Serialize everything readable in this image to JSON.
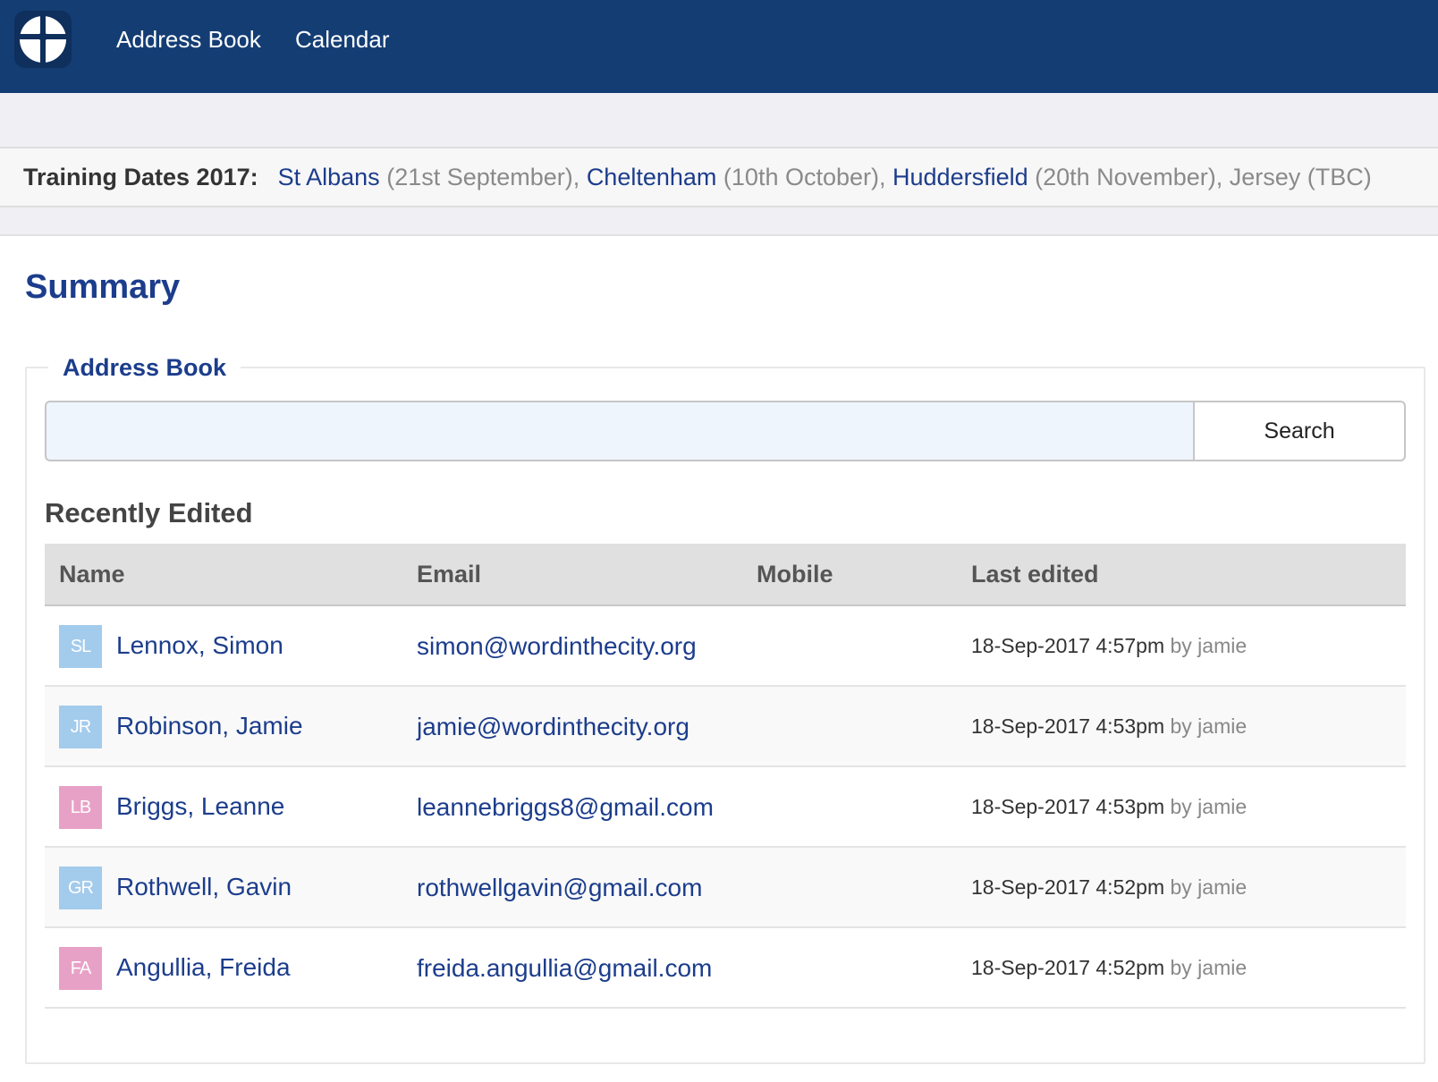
{
  "nav": {
    "logo_icon": "cross-logo-icon",
    "items": [
      "Address Book",
      "Calendar"
    ]
  },
  "training": {
    "label": "Training Dates 2017:",
    "entries": [
      {
        "city": "St Albans",
        "detail": "(21st September),"
      },
      {
        "city": "Cheltenham",
        "detail": "(10th October),"
      },
      {
        "city": "Huddersfield",
        "detail": "(20th November), Jersey (TBC)"
      }
    ]
  },
  "main": {
    "title": "Summary",
    "address_book": {
      "legend": "Address Book",
      "search": {
        "value": "",
        "placeholder": "",
        "button_label": "Search"
      },
      "recent_title": "Recently Edited",
      "columns": [
        "Name",
        "Email",
        "Mobile",
        "Last edited"
      ],
      "rows": [
        {
          "initials": "SL",
          "avatar_color": "#a3cbec",
          "name": "Lennox, Simon",
          "email": "simon@wordinthecity.org",
          "mobile": "",
          "edited": "18-Sep-2017 4:57pm",
          "by": "by jamie"
        },
        {
          "initials": "JR",
          "avatar_color": "#a3cbec",
          "name": "Robinson, Jamie",
          "email": "jamie@wordinthecity.org",
          "mobile": "",
          "edited": "18-Sep-2017 4:53pm",
          "by": "by jamie"
        },
        {
          "initials": "LB",
          "avatar_color": "#e8a1c6",
          "name": "Briggs, Leanne",
          "email": "leannebriggs8@gmail.com",
          "mobile": "",
          "edited": "18-Sep-2017 4:53pm",
          "by": "by jamie"
        },
        {
          "initials": "GR",
          "avatar_color": "#a3cbec",
          "name": "Rothwell, Gavin",
          "email": "rothwellgavin@gmail.com",
          "mobile": "",
          "edited": "18-Sep-2017 4:52pm",
          "by": "by jamie"
        },
        {
          "initials": "FA",
          "avatar_color": "#e8a1c6",
          "name": "Angullia, Freida",
          "email": "freida.angullia@gmail.com",
          "mobile": "",
          "edited": "18-Sep-2017 4:52pm",
          "by": "by jamie"
        }
      ]
    }
  },
  "colors": {
    "navbar": "#143d74",
    "accent": "#1c3d8c",
    "avatar_blue": "#a3cbec",
    "avatar_pink": "#e8a1c6"
  }
}
